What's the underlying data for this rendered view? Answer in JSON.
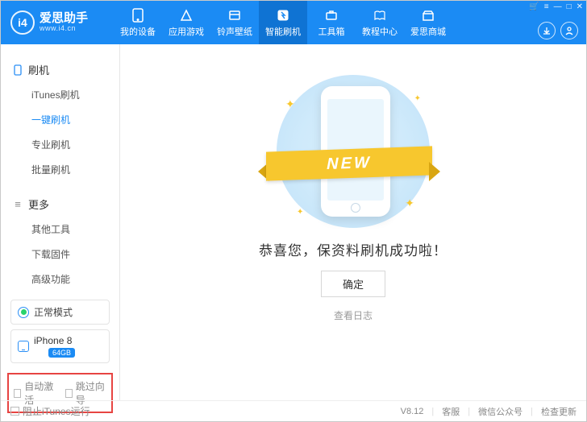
{
  "branding": {
    "name": "爱思助手",
    "url": "www.i4.cn",
    "logo_letters": "i4"
  },
  "window_controls": {
    "cart": "🛒",
    "menu": "≡",
    "min": "—",
    "max": "□",
    "close": "✕"
  },
  "header_icons": {
    "download": "↓",
    "user": "◯"
  },
  "nav": [
    {
      "label": "我的设备"
    },
    {
      "label": "应用游戏"
    },
    {
      "label": "铃声壁纸"
    },
    {
      "label": "智能刷机"
    },
    {
      "label": "工具箱"
    },
    {
      "label": "教程中心"
    },
    {
      "label": "爱思商城"
    }
  ],
  "sidebar": {
    "group1_title": "刷机",
    "group1_items": [
      "iTunes刷机",
      "一键刷机",
      "专业刷机",
      "批量刷机"
    ],
    "group2_title": "更多",
    "group2_items": [
      "其他工具",
      "下载固件",
      "高级功能"
    ]
  },
  "mode_button": "正常模式",
  "device": {
    "name": "iPhone 8",
    "storage": "64GB"
  },
  "checks": {
    "auto_activate": "自动激活",
    "skip_guide": "跳过向导"
  },
  "ribbon_text": "NEW",
  "headline": "恭喜您，保资料刷机成功啦！",
  "ok_button": "确定",
  "log_link": "查看日志",
  "footer": {
    "block_itunes": "阻止iTunes运行",
    "version": "V8.12",
    "svc": "客服",
    "wechat": "微信公众号",
    "update": "检查更新"
  }
}
